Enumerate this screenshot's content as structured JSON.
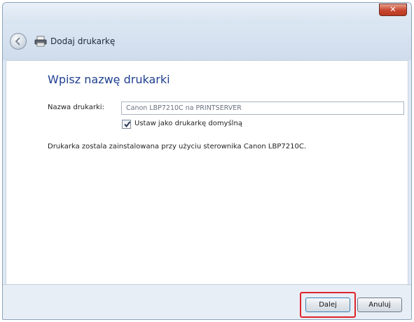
{
  "window": {
    "close_label": "✕"
  },
  "nav": {
    "title": "Dodaj drukarkę"
  },
  "main": {
    "heading": "Wpisz nazwę drukarki",
    "printer_name_label": "Nazwa drukarki:",
    "printer_name_value": "Canon LBP7210C na PRINTSERVER",
    "default_checkbox_label": "Ustaw jako drukarkę domyślną",
    "default_checkbox_checked": true,
    "info_text": "Drukarka zostala zainstalowana przy użyciu sterownika Canon LBP7210C."
  },
  "footer": {
    "next_label": "Dalej",
    "cancel_label": "Anuluj"
  },
  "colors": {
    "heading": "#1f3f8f",
    "highlight": "#e0242b",
    "close_button": "#c7452d"
  }
}
